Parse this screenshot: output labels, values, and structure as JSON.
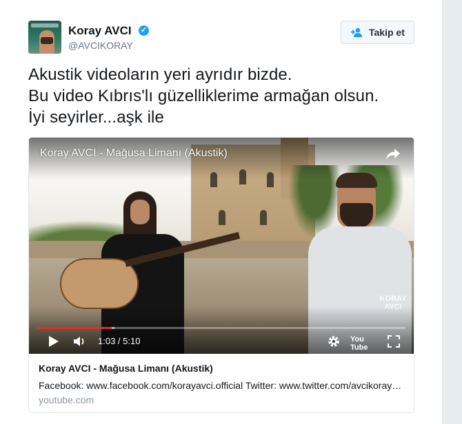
{
  "author": {
    "name": "Koray AVCI",
    "handle": "@AVCIKORAY",
    "verified_mark": "✓"
  },
  "follow_button": {
    "label": "Takip et",
    "icon": "add-user-icon"
  },
  "tweet": {
    "text": "Akustik videoların yeri ayrıdır bizde.\nBu video Kıbrıs'lı güzelliklerime armağan olsun.\nİyi seyirler...aşk ile"
  },
  "video": {
    "title": "Koray AVCI - Mağusa Limanı (Akustik)",
    "time": "1:03 / 5:10",
    "progress_fraction": 0.203,
    "buffered_fraction": 0.21,
    "watermark_line1": "KORAY",
    "watermark_line2": "AVCI",
    "youtube_label": "You Tube"
  },
  "link_card": {
    "title": "Koray AVCI - Mağusa Limanı (Akustik)",
    "description": "Facebook: www.facebook.com/korayavci.official Twitter: www.twitter.com/avcikoray Instagram",
    "domain": "youtube.com"
  },
  "colors": {
    "progress": "#e52d27",
    "verified": "#1da1f2",
    "domain_text": "#8899a6"
  }
}
